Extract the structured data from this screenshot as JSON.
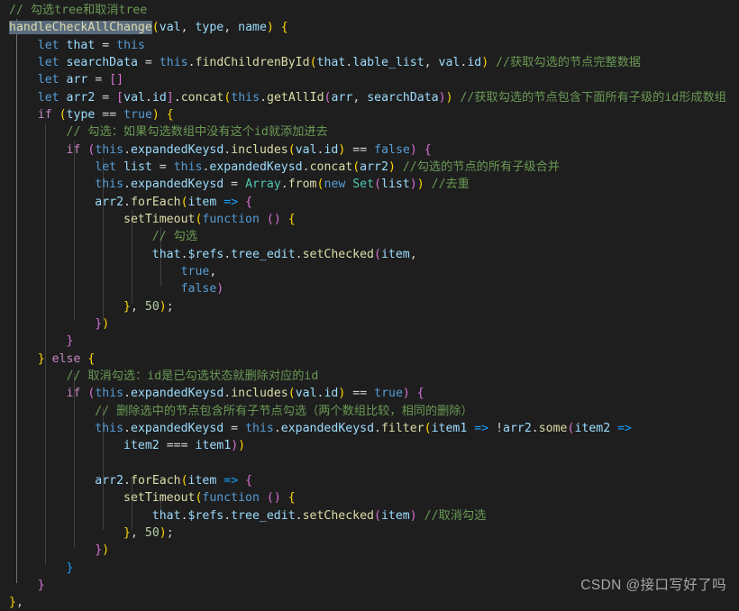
{
  "editor": {
    "background": "#1e1e1e",
    "language": "javascript",
    "font_size_px": 13.2,
    "line_height_px": 19.33,
    "highlighted_symbol": "handleCheckAllChange",
    "colors": {
      "comment": "#6A9955",
      "keyword": "#C586C0",
      "keyword_alt": "#569CD6",
      "variable": "#9CDCFE",
      "function": "#DCDCAA",
      "class": "#4EC9B0",
      "number": "#B5CEA8",
      "plain": "#D4D4D4",
      "bracket_1": "#FFD700",
      "bracket_2": "#DA70D6",
      "bracket_3": "#179FFF",
      "selection_highlight": "#5a6b7d",
      "indent_guide": "#404040",
      "indent_guide_active": "#707070"
    }
  },
  "code": {
    "lines": [
      "// 勾选tree和取消tree",
      "handleCheckAllChange(val, type, name) {",
      "    let that = this",
      "    let searchData = this.findChildrenById(that.lable_list, val.id) //获取勾选的节点完整数据",
      "    let arr = []",
      "    let arr2 = [val.id].concat(this.getAllId(arr, searchData)) //获取勾选的节点包含下面所有子级的id形成数组",
      "    if (type == true) {",
      "        // 勾选：如果勾选数组中没有这个id就添加进去",
      "        if (this.expandedKeysd.includes(val.id) == false) {",
      "            let list = this.expandedKeysd.concat(arr2) //勾选的节点的所有子级合并",
      "            this.expandedKeysd = Array.from(new Set(list)) //去重",
      "            arr2.forEach(item => {",
      "                setTimeout(function () {",
      "                    // 勾选",
      "                    that.$refs.tree_edit.setChecked(item,",
      "                        true,",
      "                        false)",
      "                }, 50);",
      "            })",
      "        }",
      "    } else {",
      "        // 取消勾选：id是已勾选状态就删除对应的id",
      "        if (this.expandedKeysd.includes(val.id) == true) {",
      "            // 删除选中的节点包含所有子节点勾选（两个数组比较，相同的删除）",
      "            this.expandedKeysd = this.expandedKeysd.filter(item1 => !arr2.some(item2 =>",
      "                item2 === item1))",
      "",
      "            arr2.forEach(item => {",
      "                setTimeout(function () {",
      "                    that.$refs.tree_edit.setChecked(item) //取消勾选",
      "                }, 50);",
      "            })",
      "        }",
      "    }",
      "},"
    ],
    "comments": [
      "// 勾选tree和取消tree",
      "//获取勾选的节点完整数据",
      "//获取勾选的节点包含下面所有子级的id形成数组",
      "// 勾选：如果勾选数组中没有这个id就添加进去",
      "//勾选的节点的所有子级合并",
      "//去重",
      "// 勾选",
      "// 取消勾选：id是已勾选状态就删除对应的id",
      "// 删除选中的节点包含所有子节点勾选（两个数组比较，相同的删除）",
      "//取消勾选"
    ]
  },
  "watermark": {
    "text": "CSDN @接口写好了吗"
  }
}
